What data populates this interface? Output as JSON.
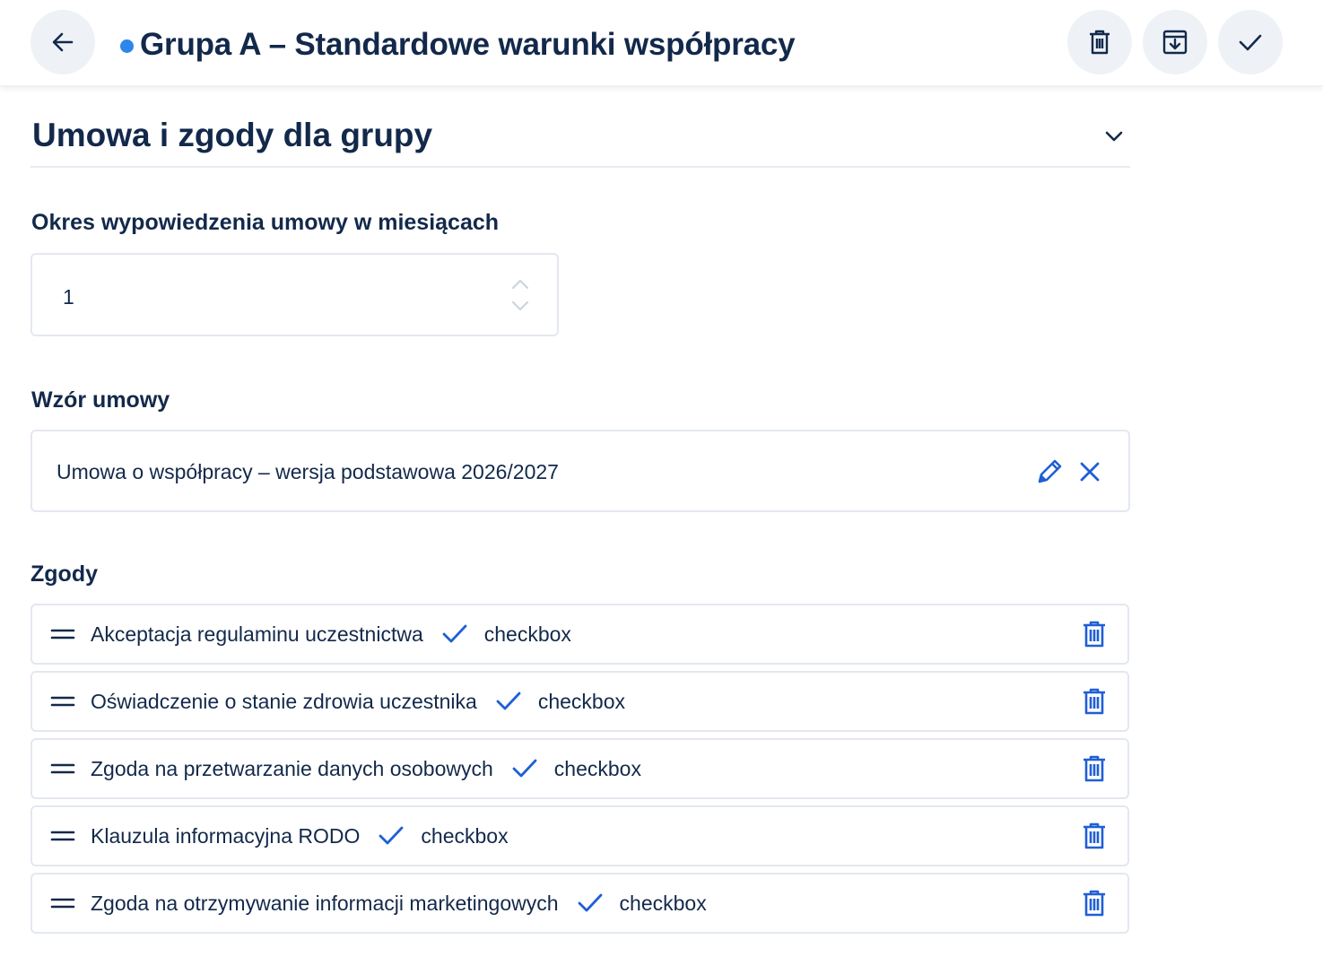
{
  "header": {
    "title": "Grupa A – Standardowe warunki współpracy",
    "status_color": "#2e86ea"
  },
  "toolbar": {
    "icons": [
      "arrow-left-icon",
      "trash-icon",
      "archive-download-icon",
      "check-icon"
    ]
  },
  "section": {
    "title": "Umowa i zgody dla grupy",
    "expanded": true
  },
  "notice": {
    "label": "Okres wypowiedzenia umowy w miesiącach",
    "value": "1"
  },
  "template": {
    "label": "Wzór umowy",
    "value": "Umowa o współpracy – wersja podstawowa 2026/2027"
  },
  "consents": {
    "label": "Zgody",
    "items": [
      {
        "label": "Akceptacja regulaminu uczestnictwa",
        "type": "checkbox"
      },
      {
        "label": "Oświadczenie o stanie zdrowia uczestnika",
        "type": "checkbox"
      },
      {
        "label": "Zgoda na przetwarzanie danych osobowych",
        "type": "checkbox"
      },
      {
        "label": "Klauzula informacyjna RODO",
        "type": "checkbox"
      },
      {
        "label": "Zgoda na otrzymywanie informacji marketingowych",
        "type": "checkbox"
      }
    ]
  },
  "colors": {
    "primary_text": "#13294b",
    "accent": "#1f5fd6",
    "border": "#e3e8ef",
    "button_bg": "#eef2f7"
  }
}
